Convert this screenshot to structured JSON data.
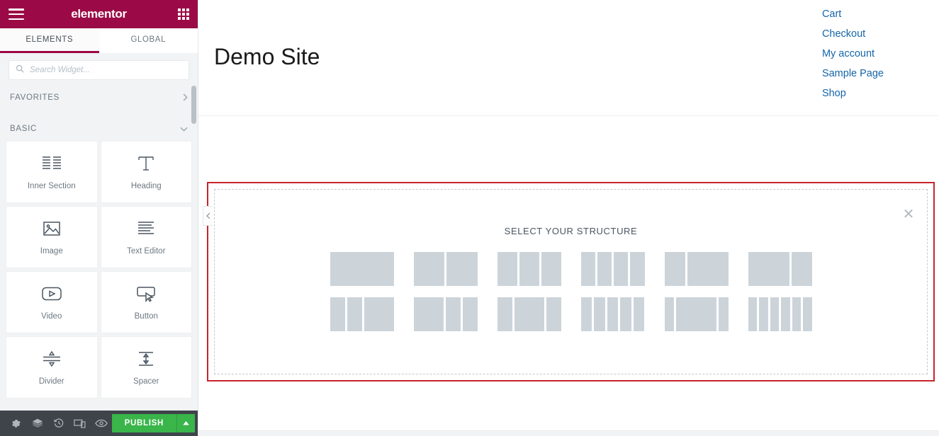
{
  "panel": {
    "header": {
      "brand": "elementor",
      "menu_icon": "hamburger-menu-icon",
      "grid_icon": "app-grid-icon",
      "background_color": "#9b0a46"
    },
    "tabs": [
      {
        "label": "ELEMENTS",
        "active": true
      },
      {
        "label": "GLOBAL",
        "active": false
      }
    ],
    "search": {
      "placeholder": "Search Widget...",
      "value": "",
      "icon": "search-icon"
    },
    "categories": [
      {
        "label": "FAVORITES",
        "expanded": false,
        "chevron": "›"
      },
      {
        "label": "BASIC",
        "expanded": true,
        "chevron": "⌄"
      }
    ],
    "widgets": [
      {
        "label": "Inner Section",
        "icon": "inner-section-icon"
      },
      {
        "label": "Heading",
        "icon": "heading-t-icon"
      },
      {
        "label": "Image",
        "icon": "image-icon"
      },
      {
        "label": "Text Editor",
        "icon": "text-editor-icon"
      },
      {
        "label": "Video",
        "icon": "video-play-icon"
      },
      {
        "label": "Button",
        "icon": "button-cursor-icon"
      },
      {
        "label": "Divider",
        "icon": "divider-icon"
      },
      {
        "label": "Spacer",
        "icon": "spacer-icon"
      }
    ],
    "footer": {
      "buttons": [
        {
          "name": "settings-gear-icon",
          "title": "Settings"
        },
        {
          "name": "navigator-layers-icon",
          "title": "Navigator"
        },
        {
          "name": "history-clock-icon",
          "title": "History"
        },
        {
          "name": "responsive-mode-icon",
          "title": "Responsive Mode"
        },
        {
          "name": "preview-eye-icon",
          "title": "Preview Changes"
        }
      ],
      "publish_label": "PUBLISH",
      "publish_color": "#39b54a",
      "publish_arrow": "▲"
    }
  },
  "canvas": {
    "site_title": "Demo Site",
    "nav_links": [
      "Cart",
      "Checkout",
      "My account",
      "Sample Page",
      "Shop"
    ],
    "nav_link_color": "#1565a8",
    "collapse_handle_icon": "chevron-left-icon",
    "add_section": {
      "title": "SELECT YOUR STRUCTURE",
      "close_icon": "close-x-icon",
      "highlight_color": "#c8232c",
      "presets": [
        {
          "name": "one-column",
          "columns": [
            100
          ]
        },
        {
          "name": "two-columns",
          "columns": [
            50,
            50
          ]
        },
        {
          "name": "three-columns",
          "columns": [
            33,
            33,
            33
          ]
        },
        {
          "name": "four-columns",
          "columns": [
            25,
            25,
            25,
            25
          ]
        },
        {
          "name": "left-third-right-twothirds",
          "columns": [
            33,
            66
          ]
        },
        {
          "name": "left-twothirds-right-third",
          "columns": [
            66,
            33
          ]
        },
        {
          "name": "quarter-quarter-half",
          "columns": [
            25,
            25,
            50
          ]
        },
        {
          "name": "half-quarter-quarter",
          "columns": [
            50,
            25,
            25
          ]
        },
        {
          "name": "quarter-half-quarter",
          "columns": [
            25,
            50,
            25
          ]
        },
        {
          "name": "five-columns",
          "columns": [
            20,
            20,
            20,
            20,
            20
          ]
        },
        {
          "name": "narrow-wide-narrow",
          "columns": [
            16,
            68,
            16
          ]
        },
        {
          "name": "six-columns",
          "columns": [
            16,
            16,
            16,
            16,
            16,
            16
          ]
        }
      ]
    }
  }
}
